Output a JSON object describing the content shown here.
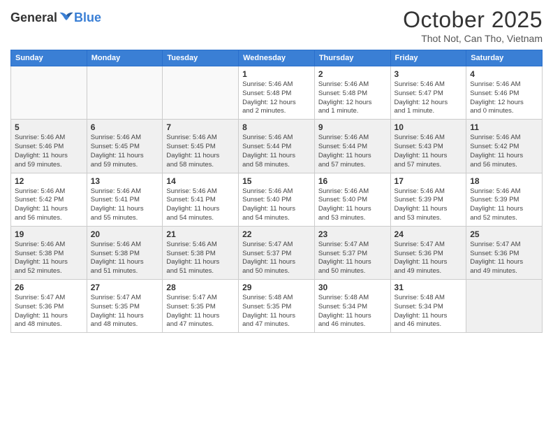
{
  "logo": {
    "general": "General",
    "blue": "Blue"
  },
  "header": {
    "month": "October 2025",
    "location": "Thot Not, Can Tho, Vietnam"
  },
  "weekdays": [
    "Sunday",
    "Monday",
    "Tuesday",
    "Wednesday",
    "Thursday",
    "Friday",
    "Saturday"
  ],
  "weeks": [
    [
      {
        "day": "",
        "info": "",
        "empty": true
      },
      {
        "day": "",
        "info": "",
        "empty": true
      },
      {
        "day": "",
        "info": "",
        "empty": true
      },
      {
        "day": "1",
        "info": "Sunrise: 5:46 AM\nSunset: 5:48 PM\nDaylight: 12 hours\nand 2 minutes."
      },
      {
        "day": "2",
        "info": "Sunrise: 5:46 AM\nSunset: 5:48 PM\nDaylight: 12 hours\nand 1 minute."
      },
      {
        "day": "3",
        "info": "Sunrise: 5:46 AM\nSunset: 5:47 PM\nDaylight: 12 hours\nand 1 minute."
      },
      {
        "day": "4",
        "info": "Sunrise: 5:46 AM\nSunset: 5:46 PM\nDaylight: 12 hours\nand 0 minutes."
      }
    ],
    [
      {
        "day": "5",
        "info": "Sunrise: 5:46 AM\nSunset: 5:46 PM\nDaylight: 11 hours\nand 59 minutes."
      },
      {
        "day": "6",
        "info": "Sunrise: 5:46 AM\nSunset: 5:45 PM\nDaylight: 11 hours\nand 59 minutes."
      },
      {
        "day": "7",
        "info": "Sunrise: 5:46 AM\nSunset: 5:45 PM\nDaylight: 11 hours\nand 58 minutes."
      },
      {
        "day": "8",
        "info": "Sunrise: 5:46 AM\nSunset: 5:44 PM\nDaylight: 11 hours\nand 58 minutes."
      },
      {
        "day": "9",
        "info": "Sunrise: 5:46 AM\nSunset: 5:44 PM\nDaylight: 11 hours\nand 57 minutes."
      },
      {
        "day": "10",
        "info": "Sunrise: 5:46 AM\nSunset: 5:43 PM\nDaylight: 11 hours\nand 57 minutes."
      },
      {
        "day": "11",
        "info": "Sunrise: 5:46 AM\nSunset: 5:42 PM\nDaylight: 11 hours\nand 56 minutes."
      }
    ],
    [
      {
        "day": "12",
        "info": "Sunrise: 5:46 AM\nSunset: 5:42 PM\nDaylight: 11 hours\nand 56 minutes."
      },
      {
        "day": "13",
        "info": "Sunrise: 5:46 AM\nSunset: 5:41 PM\nDaylight: 11 hours\nand 55 minutes."
      },
      {
        "day": "14",
        "info": "Sunrise: 5:46 AM\nSunset: 5:41 PM\nDaylight: 11 hours\nand 54 minutes."
      },
      {
        "day": "15",
        "info": "Sunrise: 5:46 AM\nSunset: 5:40 PM\nDaylight: 11 hours\nand 54 minutes."
      },
      {
        "day": "16",
        "info": "Sunrise: 5:46 AM\nSunset: 5:40 PM\nDaylight: 11 hours\nand 53 minutes."
      },
      {
        "day": "17",
        "info": "Sunrise: 5:46 AM\nSunset: 5:39 PM\nDaylight: 11 hours\nand 53 minutes."
      },
      {
        "day": "18",
        "info": "Sunrise: 5:46 AM\nSunset: 5:39 PM\nDaylight: 11 hours\nand 52 minutes."
      }
    ],
    [
      {
        "day": "19",
        "info": "Sunrise: 5:46 AM\nSunset: 5:38 PM\nDaylight: 11 hours\nand 52 minutes."
      },
      {
        "day": "20",
        "info": "Sunrise: 5:46 AM\nSunset: 5:38 PM\nDaylight: 11 hours\nand 51 minutes."
      },
      {
        "day": "21",
        "info": "Sunrise: 5:46 AM\nSunset: 5:38 PM\nDaylight: 11 hours\nand 51 minutes."
      },
      {
        "day": "22",
        "info": "Sunrise: 5:47 AM\nSunset: 5:37 PM\nDaylight: 11 hours\nand 50 minutes."
      },
      {
        "day": "23",
        "info": "Sunrise: 5:47 AM\nSunset: 5:37 PM\nDaylight: 11 hours\nand 50 minutes."
      },
      {
        "day": "24",
        "info": "Sunrise: 5:47 AM\nSunset: 5:36 PM\nDaylight: 11 hours\nand 49 minutes."
      },
      {
        "day": "25",
        "info": "Sunrise: 5:47 AM\nSunset: 5:36 PM\nDaylight: 11 hours\nand 49 minutes."
      }
    ],
    [
      {
        "day": "26",
        "info": "Sunrise: 5:47 AM\nSunset: 5:36 PM\nDaylight: 11 hours\nand 48 minutes."
      },
      {
        "day": "27",
        "info": "Sunrise: 5:47 AM\nSunset: 5:35 PM\nDaylight: 11 hours\nand 48 minutes."
      },
      {
        "day": "28",
        "info": "Sunrise: 5:47 AM\nSunset: 5:35 PM\nDaylight: 11 hours\nand 47 minutes."
      },
      {
        "day": "29",
        "info": "Sunrise: 5:48 AM\nSunset: 5:35 PM\nDaylight: 11 hours\nand 47 minutes."
      },
      {
        "day": "30",
        "info": "Sunrise: 5:48 AM\nSunset: 5:34 PM\nDaylight: 11 hours\nand 46 minutes."
      },
      {
        "day": "31",
        "info": "Sunrise: 5:48 AM\nSunset: 5:34 PM\nDaylight: 11 hours\nand 46 minutes."
      },
      {
        "day": "",
        "info": "",
        "empty": true
      }
    ]
  ]
}
